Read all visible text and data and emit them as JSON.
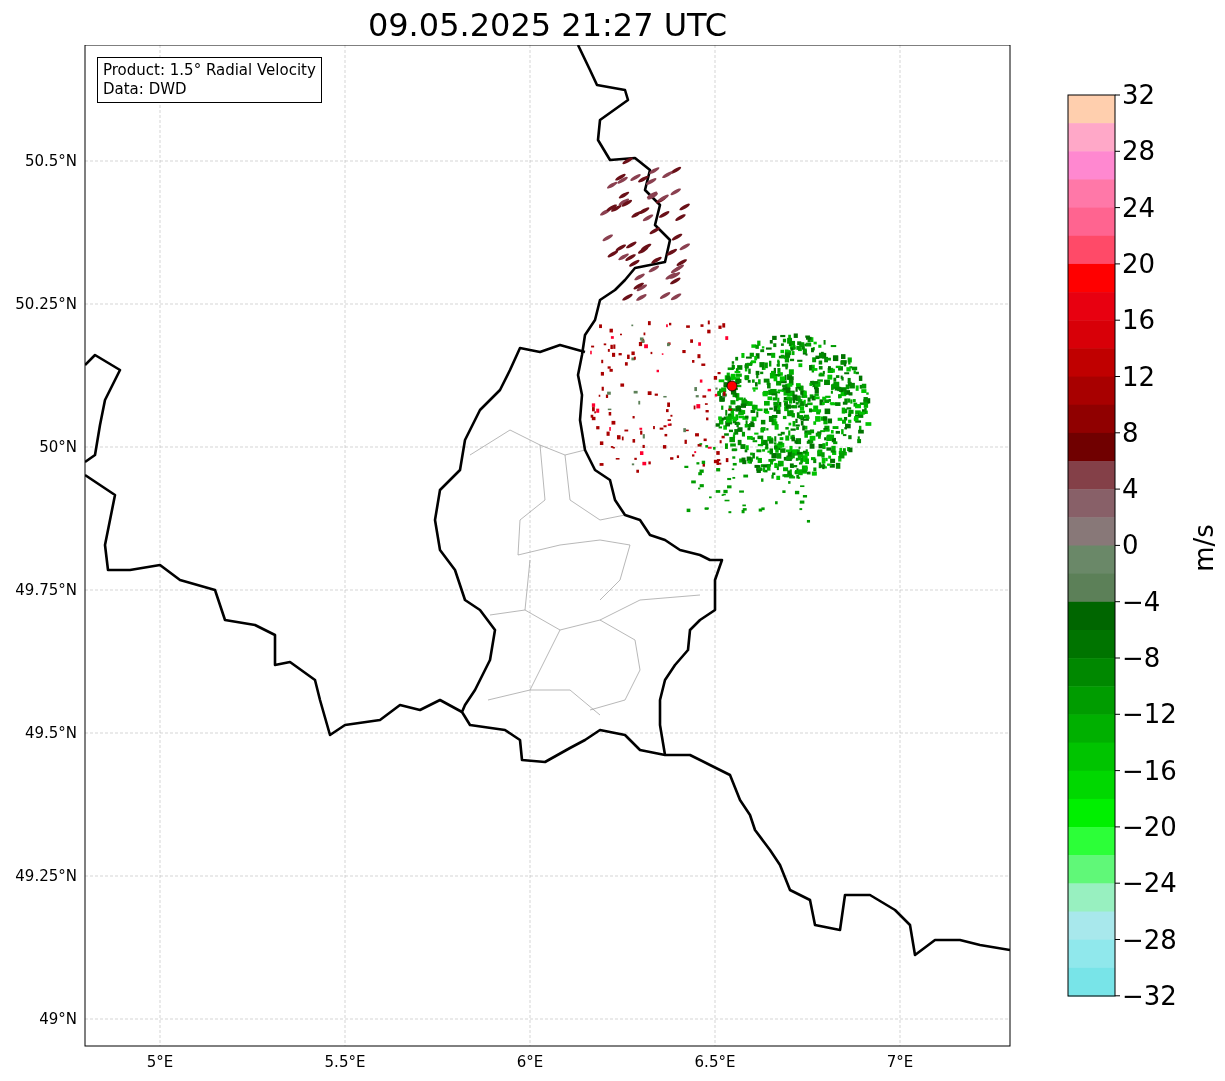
{
  "title": "09.05.2025 21:27 UTC",
  "legend": [
    "Product: 1.5° Radial Velocity",
    "Data: DWD"
  ],
  "map": {
    "lat_ticks": [
      "50.5°N",
      "50.25°N",
      "50°N",
      "49.75°N",
      "49.5°N",
      "49.25°N",
      "49°N"
    ],
    "lon_ticks": [
      "5°E",
      "5.5°E",
      "6°E",
      "6.5°E",
      "7°E"
    ]
  },
  "colorbar": {
    "label": "m/s",
    "ticks": [
      "32",
      "28",
      "24",
      "20",
      "16",
      "12",
      "8",
      "4",
      "0",
      "−4",
      "−8",
      "−12",
      "−16",
      "−20",
      "−24",
      "−28",
      "−32"
    ],
    "segments": [
      {
        "color": "#ffcfae"
      },
      {
        "color": "#ffa8c8"
      },
      {
        "color": "#ff88d0"
      },
      {
        "color": "#ff78a8"
      },
      {
        "color": "#ff6490"
      },
      {
        "color": "#ff4a68"
      },
      {
        "color": "#ff0000"
      },
      {
        "color": "#e80010"
      },
      {
        "color": "#d80008"
      },
      {
        "color": "#c00000"
      },
      {
        "color": "#a80000"
      },
      {
        "color": "#900000"
      },
      {
        "color": "#700000"
      },
      {
        "color": "#844048"
      },
      {
        "color": "#886068"
      },
      {
        "color": "#887878"
      },
      {
        "color": "#6a8868"
      },
      {
        "color": "#5c8058"
      },
      {
        "color": "#006600"
      },
      {
        "color": "#007400"
      },
      {
        "color": "#008800"
      },
      {
        "color": "#009c00"
      },
      {
        "color": "#00b000"
      },
      {
        "color": "#00c400"
      },
      {
        "color": "#00d800"
      },
      {
        "color": "#00f000"
      },
      {
        "color": "#2cff38"
      },
      {
        "color": "#60f878"
      },
      {
        "color": "#98f0c0"
      },
      {
        "color": "#a8e8ec"
      },
      {
        "color": "#90e8ec"
      },
      {
        "color": "#78e4e8"
      }
    ]
  }
}
